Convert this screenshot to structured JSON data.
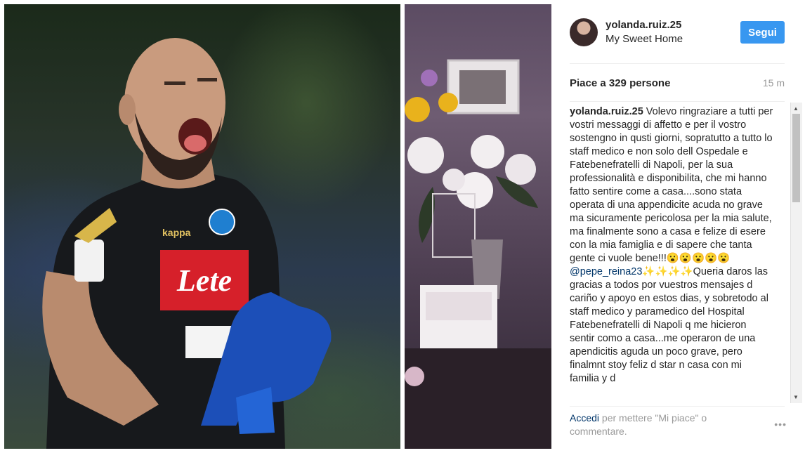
{
  "post": {
    "username": "yolanda.ruiz.25",
    "location": "My Sweet Home",
    "follow_label": "Segui",
    "likes_text": "Piace a 329 persone",
    "time_ago": "15 m",
    "caption_author": "yolanda.ruiz.25",
    "caption_part1": "Volevo ringraziare a tutti per vostri messaggi di affetto e per il vostro sostengno in qusti giorni, sopratutto a tutto lo staff medico e non solo dell Ospedale e Fatebenefratelli di Napoli, per la sua professionalità e disponibilita, che mi hanno fatto sentire come a casa....sono stata operata di una appendicite acuda no grave ma sicuramente pericolosa per la mia salute, ma finalmente sono a casa e felize di esere con la mia famiglia e di sapere che tanta gente ci vuole bene!!!😮😮😮😮😮",
    "caption_mention": "@pepe_reina23",
    "caption_part2": "✨✨✨✨Queria daros las gracias a todos por vuestros mensajes d cariño y apoyo en estos dias, y sobretodo al staff medico y paramedico del Hospital Fatebenefratelli di Napoli q me hicieron sentir como a casa...me operaron de una apendicitis aguda un poco grave, pero finalmnt stoy feliz d star n casa con mi familia y d",
    "login_link": "Accedi",
    "login_text": "per mettere \"Mi piace\" o commentare."
  },
  "photo_left": {
    "shirt_sponsor": "Lete",
    "shirt_brand": "kappa"
  },
  "icons": {
    "more": "more-dots-icon",
    "scroll_up": "scroll-up-arrow-icon",
    "scroll_down": "scroll-down-arrow-icon"
  },
  "colors": {
    "follow_button": "#3897f0",
    "link": "#003569",
    "secondary_text": "#999999",
    "shirt_red": "#d6202a"
  }
}
